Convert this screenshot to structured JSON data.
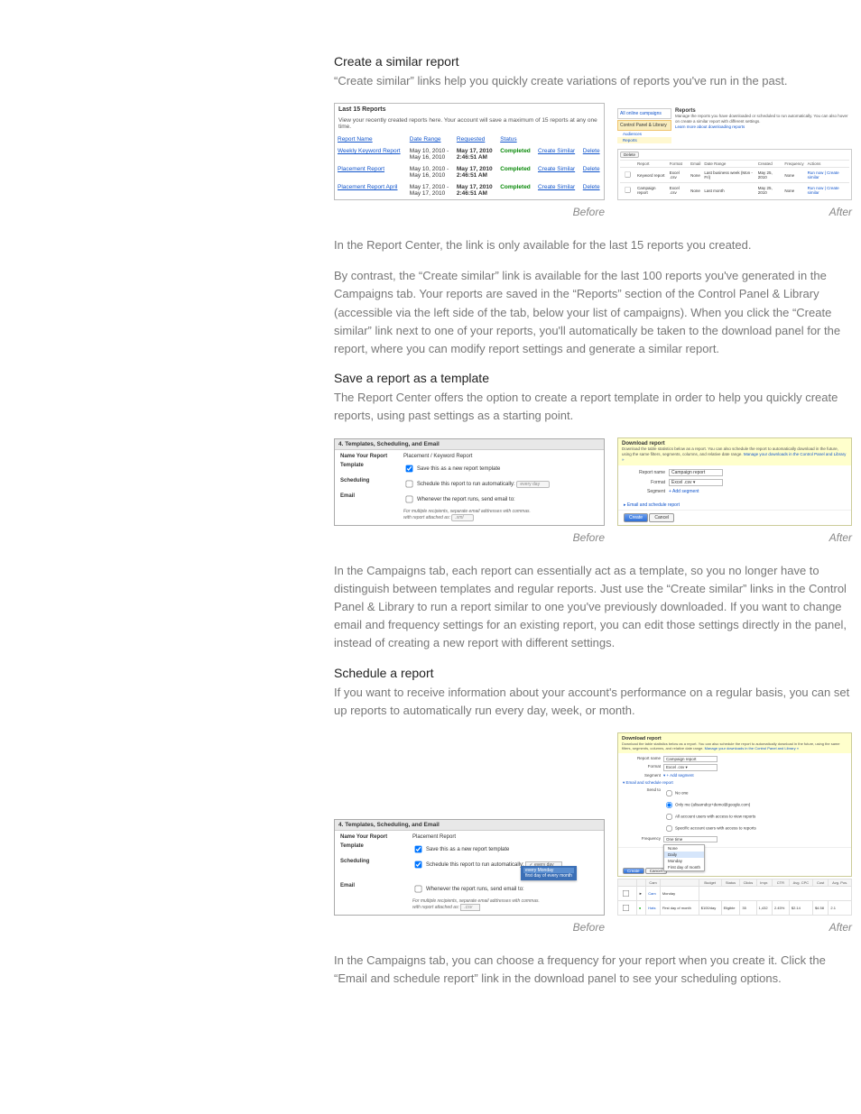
{
  "section1": {
    "heading": "Create a similar report",
    "intro": "“Create similar” links help you quickly create variations of reports you've run in the past.",
    "before_label": "Before",
    "after_label": "After",
    "last15": {
      "title": "Last 15 Reports",
      "sub": "View your recently created reports here. Your account will save a maximum of 15 reports at any one time.",
      "headers": [
        "Report Name",
        "Date Range",
        "Requested",
        "Status",
        "",
        ""
      ],
      "create_similar": "Create Similar",
      "delete": "Delete",
      "completed": "Completed",
      "rows": [
        {
          "name": "Weekly Keyword Report",
          "range": "May 10, 2010 -\nMay 16, 2010",
          "req": "May 17, 2010\n2:46:51 AM"
        },
        {
          "name": "Placement Report",
          "range": "May 10, 2010 -\nMay 16, 2010",
          "req": "May 17, 2010\n2:46:51 AM"
        },
        {
          "name": "Placement Report April",
          "range": "May 17, 2010 -\nMay 17, 2010",
          "req": "May 17, 2010\n2:46:51 AM"
        }
      ]
    },
    "reports_after": {
      "side": {
        "all_online": "All online campaigns",
        "cpl": "Control Panel & Library",
        "audiences": "Audiences",
        "reports": "Reports"
      },
      "title": "Reports",
      "desc": "Manage the reports you have downloaded or scheduled to run automatically. You can also hover on create a similar report with different settings.",
      "learn": "Learn more about downloading reports",
      "delete_btn": "Delete",
      "headers": [
        "",
        "Report",
        "Format",
        "Email",
        "Date Range",
        "Created",
        "Frequency",
        "Actions"
      ],
      "rows": [
        {
          "report": "Keyword report",
          "format": "Excel .csv",
          "email": "None",
          "range": "Last business week (Mon - Fri)",
          "created": "May 25, 2010",
          "freq": "None",
          "action": "Run now | Create similar"
        },
        {
          "report": "Campaign report",
          "format": "Excel .csv",
          "email": "None",
          "range": "Last month",
          "created": "May 25, 2010",
          "freq": "None",
          "action": "Run now | Create similar"
        }
      ]
    },
    "body": "In the Report Center, the link is only available for the last 15 reports you created.",
    "body2": "By contrast, the “Create similar” link is available for the last 100 reports you've generated in the Campaigns tab. Your reports are saved in the “Reports” section of the Control Panel & Library (accessible via the left side of the tab, below your list of campaigns). When you click the “Create similar” link next to one of your reports, you'll automatically be taken to the download panel for the report, where you can modify report settings and generate a similar report."
  },
  "section2": {
    "heading": "Save a report as a template",
    "intro": "The Report Center offers the option to create a report template in order to help you quickly create reports, using past settings as a starting point.",
    "before_label": "Before",
    "after_label": "After",
    "templates_before": {
      "bar": "4. Templates, Scheduling, and Email",
      "name_lbl": "Name Your Report",
      "name_val": "Placement / Keyword Report",
      "tmpl_lbl": "Template",
      "tmpl_chk": "Save this as a new report template",
      "sched_lbl": "Scheduling",
      "sched_chk": "Schedule this report to run automatically:",
      "sched_sel": "every day",
      "email_lbl": "Email",
      "email_chk": "Whenever the report runs, send email to:",
      "note1": "For multiple recipients, separate email addresses with commas.",
      "note2": "with report attached as:",
      "note2_sel": ".xml"
    },
    "dl_panel": {
      "title": "Download report",
      "desc": "Download the table statistics below as a report. You can also schedule the report to automatically download in the future, using the same filters, segments, columns, and relative date range.",
      "manage": "Manage your downloads in the Control Panel and Library »",
      "rn_lbl": "Report name",
      "rn_val": "Campaign report",
      "fmt_lbl": "Format",
      "fmt_val": "Excel .csv ▾",
      "seg_lbl": "Segment",
      "seg_add": "+ Add segment",
      "toggle": "Email and schedule report",
      "create": "Create",
      "cancel": "Cancel"
    },
    "body": "In the Campaigns tab, each report can essentially act as a template, so you no longer have to distinguish between templates and regular reports. Just use the “Create similar” links in the Control Panel & Library to run a report similar to one you've previously downloaded. If you want to change email and frequency settings for an existing report, you can edit those settings directly in the panel, instead of creating a new report with different settings."
  },
  "section3": {
    "heading": "Schedule a report",
    "intro": "If you want to receive information about your account's performance on a regular basis, you can set up reports to automatically run every day, week, or month.",
    "before_label": "Before",
    "after_label": "After",
    "sched_before": {
      "bar": "4. Templates, Scheduling, and Email",
      "name_lbl": "Name Your Report",
      "name_val": "Placement Report",
      "tmpl_lbl": "Template",
      "tmpl_chk": "Save this as a new report template",
      "sched_lbl": "Scheduling",
      "sched_chk": "Schedule this report to run automatically:",
      "sched_sel": "every day",
      "dd": [
        "every Monday",
        "first day of every month"
      ],
      "email_lbl": "Email",
      "email_chk": "Whenever the report runs, send email to:",
      "note1": "For multiple recipients, separate email addresses with commas.",
      "note2": "with report attached as:",
      "note2_sel": ".csv"
    },
    "dl_panel3": {
      "title": "Download report",
      "desc": "Download the table statistics below as a report. You can also schedule the report to automatically download in the future, using the same filters, segments, columns, and relative date range.",
      "manage": "Manage your downloads in the Control Panel and Library »",
      "rn_lbl": "Report name",
      "rn_val": "Campaign report",
      "fmt_lbl": "Format",
      "fmt_val": "Excel .csv ▾",
      "seg_lbl": "Segment",
      "seg_add": "+ Add segment",
      "toggle": "Email and schedule report",
      "sendto_lbl": "Send to",
      "radios": [
        "No one",
        "Only me (alisarndcp+demo@google.com)",
        "All account users with access to view reports",
        "Specific account users with access to reports"
      ],
      "freq_lbl": "Frequency",
      "freq_val": "One time",
      "freq_opts": [
        "None",
        "Daily",
        "Monday",
        "First day of month"
      ],
      "create": "Create",
      "cancel": "Cancel",
      "table": {
        "headers": [
          "",
          "",
          "Cam",
          "",
          "Budget",
          "Status",
          "Clicks",
          "Impr.",
          "CTR",
          "Avg. CPC",
          "Cost",
          "Avg. Pos."
        ],
        "rows": [
          [
            "",
            "►",
            "Cam",
            "Monday",
            "",
            "",
            "",
            "",
            "",
            "",
            "",
            ""
          ],
          [
            "",
            "●",
            "Hats",
            "First day of month",
            "$100/day",
            "Eligible",
            "35",
            "1,432",
            "2.45%",
            "",
            "$2.14",
            "$4.58",
            "2.1"
          ]
        ]
      }
    },
    "body": "In the Campaigns tab, you can choose a frequency for your report when you create it. Click the “Email and schedule report” link in the download panel to see your scheduling options."
  }
}
